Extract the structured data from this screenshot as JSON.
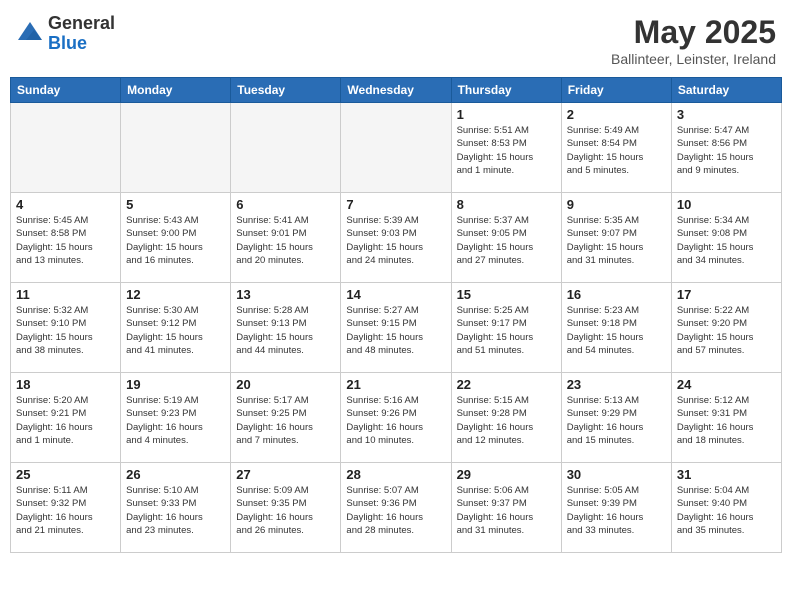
{
  "header": {
    "logo_general": "General",
    "logo_blue": "Blue",
    "month_year": "May 2025",
    "location": "Ballinteer, Leinster, Ireland"
  },
  "weekdays": [
    "Sunday",
    "Monday",
    "Tuesday",
    "Wednesday",
    "Thursday",
    "Friday",
    "Saturday"
  ],
  "weeks": [
    [
      {
        "day": "",
        "detail": "",
        "empty": true
      },
      {
        "day": "",
        "detail": "",
        "empty": true
      },
      {
        "day": "",
        "detail": "",
        "empty": true
      },
      {
        "day": "",
        "detail": "",
        "empty": true
      },
      {
        "day": "1",
        "detail": "Sunrise: 5:51 AM\nSunset: 8:53 PM\nDaylight: 15 hours\nand 1 minute.",
        "empty": false
      },
      {
        "day": "2",
        "detail": "Sunrise: 5:49 AM\nSunset: 8:54 PM\nDaylight: 15 hours\nand 5 minutes.",
        "empty": false
      },
      {
        "day": "3",
        "detail": "Sunrise: 5:47 AM\nSunset: 8:56 PM\nDaylight: 15 hours\nand 9 minutes.",
        "empty": false
      }
    ],
    [
      {
        "day": "4",
        "detail": "Sunrise: 5:45 AM\nSunset: 8:58 PM\nDaylight: 15 hours\nand 13 minutes.",
        "empty": false
      },
      {
        "day": "5",
        "detail": "Sunrise: 5:43 AM\nSunset: 9:00 PM\nDaylight: 15 hours\nand 16 minutes.",
        "empty": false
      },
      {
        "day": "6",
        "detail": "Sunrise: 5:41 AM\nSunset: 9:01 PM\nDaylight: 15 hours\nand 20 minutes.",
        "empty": false
      },
      {
        "day": "7",
        "detail": "Sunrise: 5:39 AM\nSunset: 9:03 PM\nDaylight: 15 hours\nand 24 minutes.",
        "empty": false
      },
      {
        "day": "8",
        "detail": "Sunrise: 5:37 AM\nSunset: 9:05 PM\nDaylight: 15 hours\nand 27 minutes.",
        "empty": false
      },
      {
        "day": "9",
        "detail": "Sunrise: 5:35 AM\nSunset: 9:07 PM\nDaylight: 15 hours\nand 31 minutes.",
        "empty": false
      },
      {
        "day": "10",
        "detail": "Sunrise: 5:34 AM\nSunset: 9:08 PM\nDaylight: 15 hours\nand 34 minutes.",
        "empty": false
      }
    ],
    [
      {
        "day": "11",
        "detail": "Sunrise: 5:32 AM\nSunset: 9:10 PM\nDaylight: 15 hours\nand 38 minutes.",
        "empty": false
      },
      {
        "day": "12",
        "detail": "Sunrise: 5:30 AM\nSunset: 9:12 PM\nDaylight: 15 hours\nand 41 minutes.",
        "empty": false
      },
      {
        "day": "13",
        "detail": "Sunrise: 5:28 AM\nSunset: 9:13 PM\nDaylight: 15 hours\nand 44 minutes.",
        "empty": false
      },
      {
        "day": "14",
        "detail": "Sunrise: 5:27 AM\nSunset: 9:15 PM\nDaylight: 15 hours\nand 48 minutes.",
        "empty": false
      },
      {
        "day": "15",
        "detail": "Sunrise: 5:25 AM\nSunset: 9:17 PM\nDaylight: 15 hours\nand 51 minutes.",
        "empty": false
      },
      {
        "day": "16",
        "detail": "Sunrise: 5:23 AM\nSunset: 9:18 PM\nDaylight: 15 hours\nand 54 minutes.",
        "empty": false
      },
      {
        "day": "17",
        "detail": "Sunrise: 5:22 AM\nSunset: 9:20 PM\nDaylight: 15 hours\nand 57 minutes.",
        "empty": false
      }
    ],
    [
      {
        "day": "18",
        "detail": "Sunrise: 5:20 AM\nSunset: 9:21 PM\nDaylight: 16 hours\nand 1 minute.",
        "empty": false
      },
      {
        "day": "19",
        "detail": "Sunrise: 5:19 AM\nSunset: 9:23 PM\nDaylight: 16 hours\nand 4 minutes.",
        "empty": false
      },
      {
        "day": "20",
        "detail": "Sunrise: 5:17 AM\nSunset: 9:25 PM\nDaylight: 16 hours\nand 7 minutes.",
        "empty": false
      },
      {
        "day": "21",
        "detail": "Sunrise: 5:16 AM\nSunset: 9:26 PM\nDaylight: 16 hours\nand 10 minutes.",
        "empty": false
      },
      {
        "day": "22",
        "detail": "Sunrise: 5:15 AM\nSunset: 9:28 PM\nDaylight: 16 hours\nand 12 minutes.",
        "empty": false
      },
      {
        "day": "23",
        "detail": "Sunrise: 5:13 AM\nSunset: 9:29 PM\nDaylight: 16 hours\nand 15 minutes.",
        "empty": false
      },
      {
        "day": "24",
        "detail": "Sunrise: 5:12 AM\nSunset: 9:31 PM\nDaylight: 16 hours\nand 18 minutes.",
        "empty": false
      }
    ],
    [
      {
        "day": "25",
        "detail": "Sunrise: 5:11 AM\nSunset: 9:32 PM\nDaylight: 16 hours\nand 21 minutes.",
        "empty": false
      },
      {
        "day": "26",
        "detail": "Sunrise: 5:10 AM\nSunset: 9:33 PM\nDaylight: 16 hours\nand 23 minutes.",
        "empty": false
      },
      {
        "day": "27",
        "detail": "Sunrise: 5:09 AM\nSunset: 9:35 PM\nDaylight: 16 hours\nand 26 minutes.",
        "empty": false
      },
      {
        "day": "28",
        "detail": "Sunrise: 5:07 AM\nSunset: 9:36 PM\nDaylight: 16 hours\nand 28 minutes.",
        "empty": false
      },
      {
        "day": "29",
        "detail": "Sunrise: 5:06 AM\nSunset: 9:37 PM\nDaylight: 16 hours\nand 31 minutes.",
        "empty": false
      },
      {
        "day": "30",
        "detail": "Sunrise: 5:05 AM\nSunset: 9:39 PM\nDaylight: 16 hours\nand 33 minutes.",
        "empty": false
      },
      {
        "day": "31",
        "detail": "Sunrise: 5:04 AM\nSunset: 9:40 PM\nDaylight: 16 hours\nand 35 minutes.",
        "empty": false
      }
    ]
  ]
}
